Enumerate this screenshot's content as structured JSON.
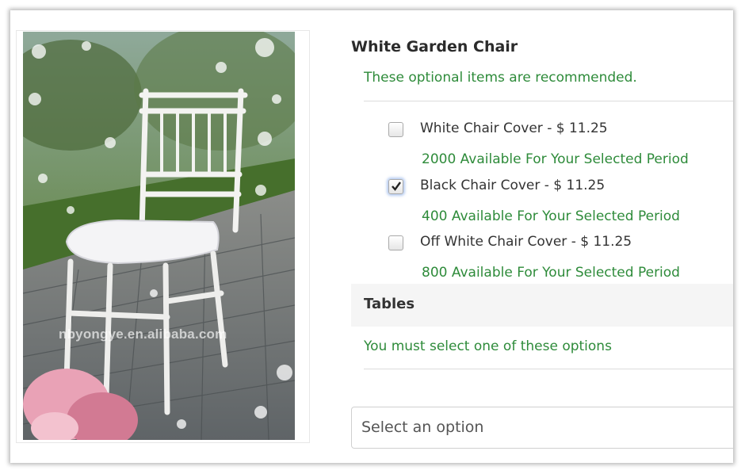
{
  "product": {
    "title": "White Garden Chair",
    "image_watermark": "nbyongye.en.alibaba.com"
  },
  "optional_items": {
    "heading": "These optional items are recommended.",
    "items": [
      {
        "label": "White Chair Cover - $ 11.25",
        "checked": false,
        "availability": "2000 Available For Your Selected Period"
      },
      {
        "label": "Black Chair Cover - $ 11.25",
        "checked": true,
        "availability": "400 Available For Your Selected Period"
      },
      {
        "label": "Off White Chair Cover - $ 11.25",
        "checked": false,
        "availability": "800 Available For Your Selected Period"
      }
    ]
  },
  "tables": {
    "heading": "Tables",
    "requirement": "You must select one of these options",
    "select_placeholder": "Select an option"
  },
  "colors": {
    "green_text": "#2e8b3a",
    "heading_text": "#2b2b2b"
  }
}
